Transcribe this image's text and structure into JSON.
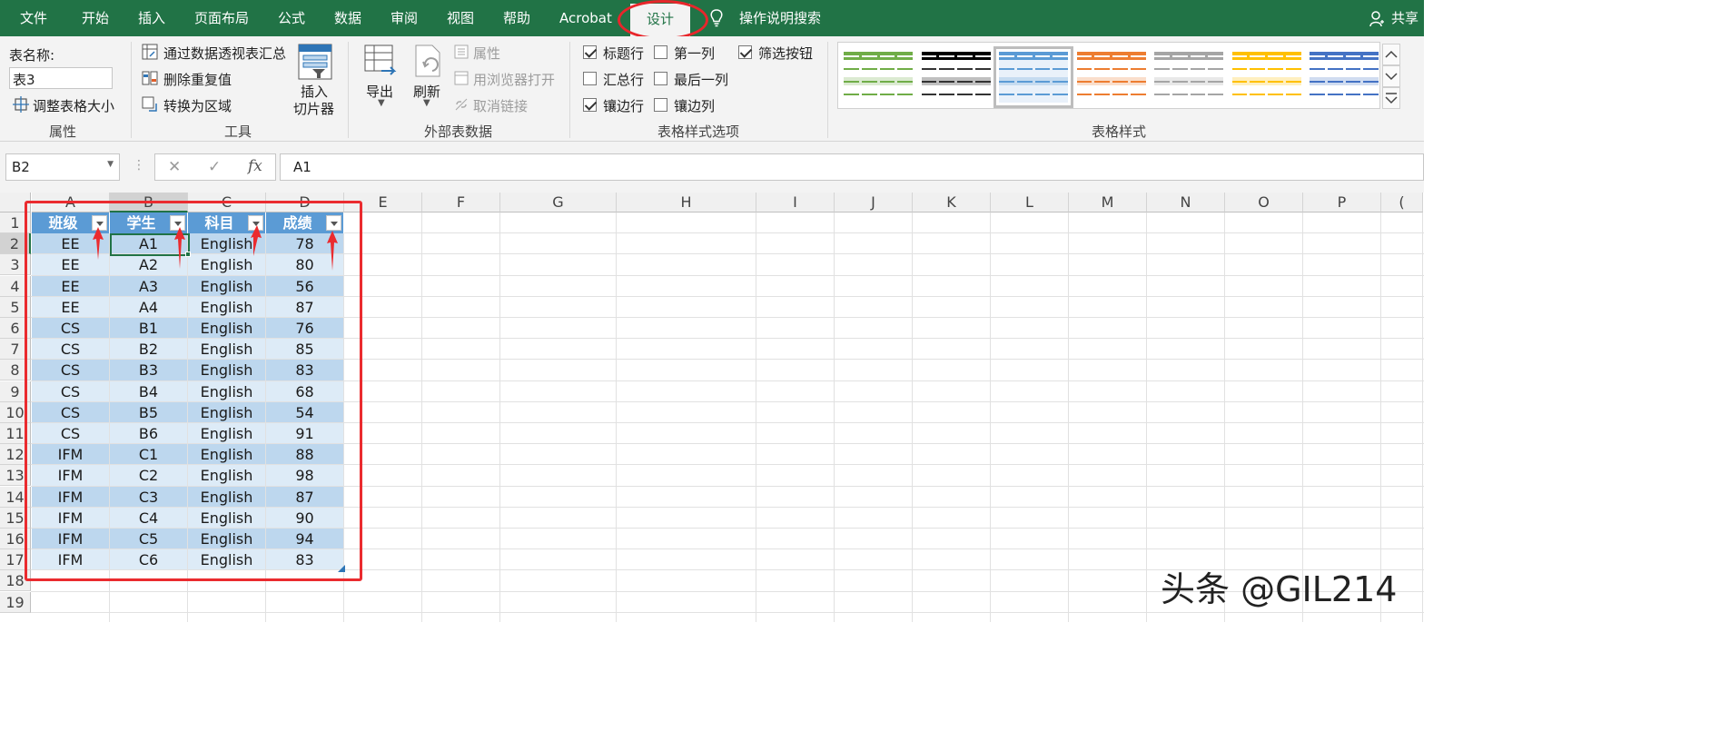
{
  "ribbon_tabs": [
    "文件",
    "开始",
    "插入",
    "页面布局",
    "公式",
    "数据",
    "审阅",
    "视图",
    "帮助",
    "Acrobat",
    "设计"
  ],
  "active_tab": "设计",
  "tell_me": "操作说明搜索",
  "share": "共享",
  "properties_group": {
    "table_name_label": "表名称:",
    "table_name_value": "表3",
    "resize_label": "调整表格大小",
    "group_label": "属性"
  },
  "tools_group": {
    "pivot_label": "通过数据透视表汇总",
    "remove_dup_label": "删除重复值",
    "convert_label": "转换为区域",
    "slicer_line1": "插入",
    "slicer_line2": "切片器",
    "group_label": "工具"
  },
  "external_group": {
    "export_label": "导出",
    "refresh_label": "刷新",
    "properties_label": "属性",
    "open_browser_label": "用浏览器打开",
    "unlink_label": "取消链接",
    "group_label": "外部表数据"
  },
  "style_options_group": {
    "header_row": "标题行",
    "first_column": "第一列",
    "filter_button": "筛选按钮",
    "total_row": "汇总行",
    "last_column": "最后一列",
    "banded_rows": "镶边行",
    "banded_columns": "镶边列",
    "group_label": "表格样式选项"
  },
  "style_options_state": {
    "header_row": true,
    "first_column": false,
    "filter_button": true,
    "total_row": false,
    "last_column": false,
    "banded_rows": true,
    "banded_columns": false
  },
  "table_styles_group": {
    "group_label": "表格样式",
    "swatch_colors": [
      "#70ad47",
      "#000000",
      "#5b9bd5",
      "#ed7d31",
      "#a5a5a5",
      "#ffc000",
      "#4472c4"
    ],
    "selected_index": 2
  },
  "formula_bar": {
    "cell_ref": "B2",
    "cancel_glyph": "✕",
    "enter_glyph": "✓",
    "fx_glyph": "fx",
    "formula": "A1"
  },
  "columns": [
    "A",
    "B",
    "C",
    "D",
    "E",
    "F",
    "G",
    "H",
    "I",
    "J",
    "K",
    "L",
    "M",
    "N",
    "O",
    "P",
    "("
  ],
  "rows": [
    "1",
    "2",
    "3",
    "4",
    "5",
    "6",
    "7",
    "8",
    "9",
    "10",
    "11",
    "12",
    "13",
    "14",
    "15",
    "16",
    "17",
    "18",
    "19"
  ],
  "table": {
    "headers": [
      "班级",
      "学生",
      "科目",
      "成绩"
    ],
    "rows": [
      [
        "EE",
        "A1",
        "English",
        "78"
      ],
      [
        "EE",
        "A2",
        "English",
        "80"
      ],
      [
        "EE",
        "A3",
        "English",
        "56"
      ],
      [
        "EE",
        "A4",
        "English",
        "87"
      ],
      [
        "CS",
        "B1",
        "English",
        "76"
      ],
      [
        "CS",
        "B2",
        "English",
        "85"
      ],
      [
        "CS",
        "B3",
        "English",
        "83"
      ],
      [
        "CS",
        "B4",
        "English",
        "68"
      ],
      [
        "CS",
        "B5",
        "English",
        "54"
      ],
      [
        "CS",
        "B6",
        "English",
        "91"
      ],
      [
        "IFM",
        "C1",
        "English",
        "88"
      ],
      [
        "IFM",
        "C2",
        "English",
        "98"
      ],
      [
        "IFM",
        "C3",
        "English",
        "87"
      ],
      [
        "IFM",
        "C4",
        "English",
        "90"
      ],
      [
        "IFM",
        "C5",
        "English",
        "94"
      ],
      [
        "IFM",
        "C6",
        "English",
        "83"
      ]
    ]
  },
  "colors": {
    "excel_green": "#217346",
    "table_header": "#5b9bd5",
    "band_dark": "#bdd7ee",
    "band_light": "#ddebf7",
    "annotation_red": "#ea2b2f"
  },
  "watermark": "头条 @GIL214"
}
